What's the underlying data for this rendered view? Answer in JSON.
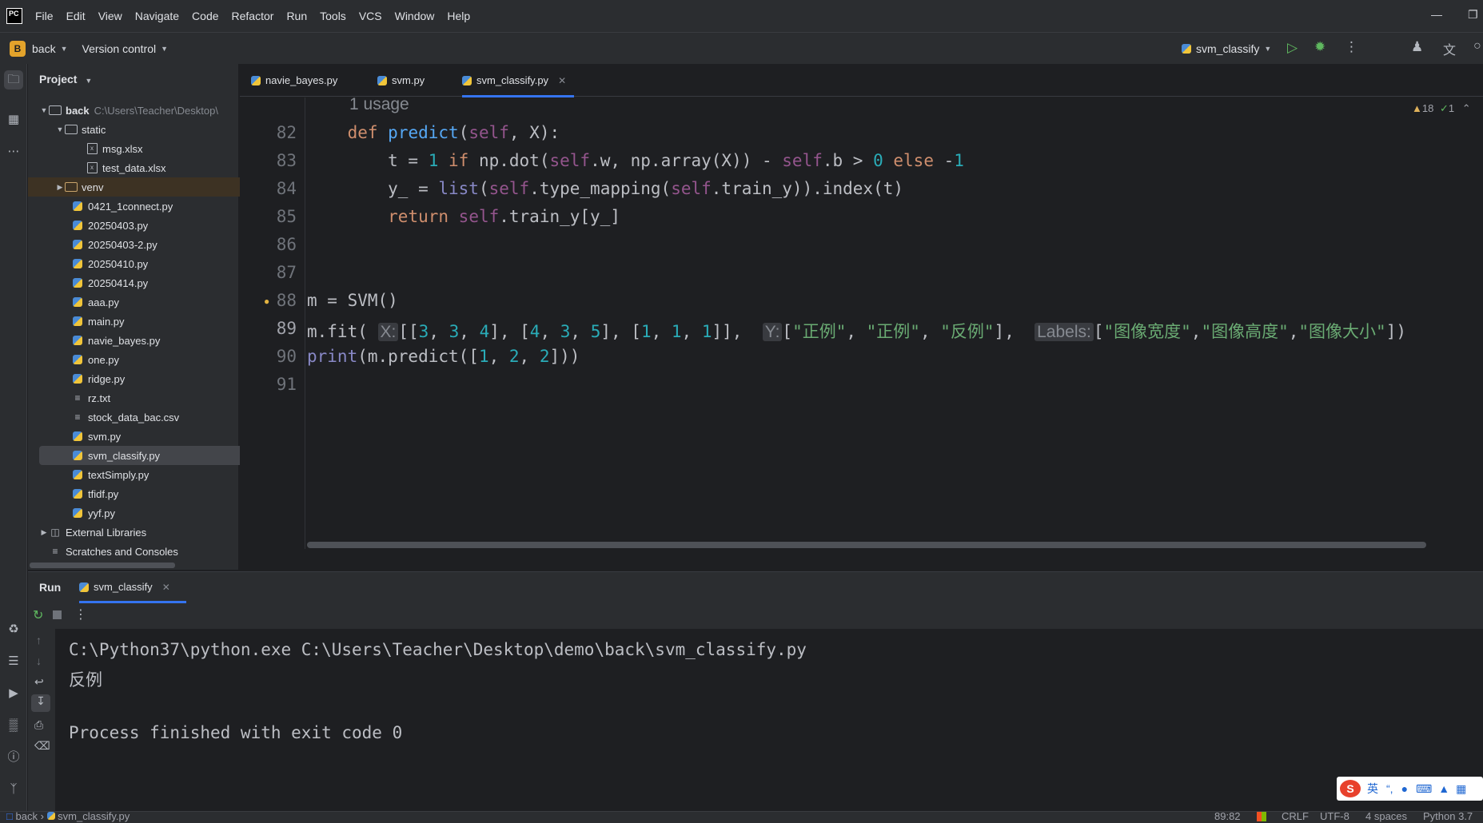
{
  "menubar": {
    "logo": "PC",
    "items": [
      "File",
      "Edit",
      "View",
      "Navigate",
      "Code",
      "Refactor",
      "Run",
      "Tools",
      "VCS",
      "Window",
      "Help"
    ]
  },
  "toolbar": {
    "project_badge": "B",
    "project_name": "back",
    "vcs": "Version control",
    "run_config": "svm_classify"
  },
  "project_pane": {
    "title": "Project",
    "root": {
      "name": "back",
      "path": "C:\\Users\\Teacher\\Desktop\\"
    },
    "items": [
      "static",
      "msg.xlsx",
      "test_data.xlsx",
      "venv",
      "0421_1connect.py",
      "20250403.py",
      "20250403-2.py",
      "20250410.py",
      "20250414.py",
      "aaa.py",
      "main.py",
      "navie_bayes.py",
      "one.py",
      "ridge.py",
      "rz.txt",
      "stock_data_bac.csv",
      "svm.py",
      "svm_classify.py",
      "textSimply.py",
      "tfidf.py",
      "yyf.py",
      "External Libraries",
      "Scratches and Consoles"
    ]
  },
  "tabs": [
    "navie_bayes.py",
    "svm.py",
    "svm_classify.py"
  ],
  "editor": {
    "usage_hint": "1 usage",
    "warnings": "18",
    "checks": "1",
    "line_numbers": [
      "82",
      "83",
      "84",
      "85",
      "86",
      "87",
      "88",
      "89",
      "90",
      "91"
    ],
    "hint_x": "X:",
    "hint_y": "Y:",
    "hint_labels": "Labels:"
  },
  "run_panel": {
    "title": "Run",
    "tab": "svm_classify",
    "output": [
      "C:\\Python37\\python.exe C:\\Users\\Teacher\\Desktop\\demo\\back\\svm_classify.py",
      "反例",
      "",
      "Process finished with exit code 0"
    ]
  },
  "statusbar": {
    "crumb_project": "back",
    "crumb_file": "svm_classify.py",
    "position": "89:82",
    "line_sep": "CRLF",
    "encoding": "UTF-8",
    "indent": "4 spaces",
    "interpreter": "Python 3.7"
  },
  "ime": {
    "lang": "英"
  },
  "colors": {
    "accent": "#3574f0",
    "keyword": "#cf8e6d",
    "function": "#56a8f5",
    "self": "#94558d",
    "number": "#2aacb8",
    "string": "#6aab73"
  }
}
